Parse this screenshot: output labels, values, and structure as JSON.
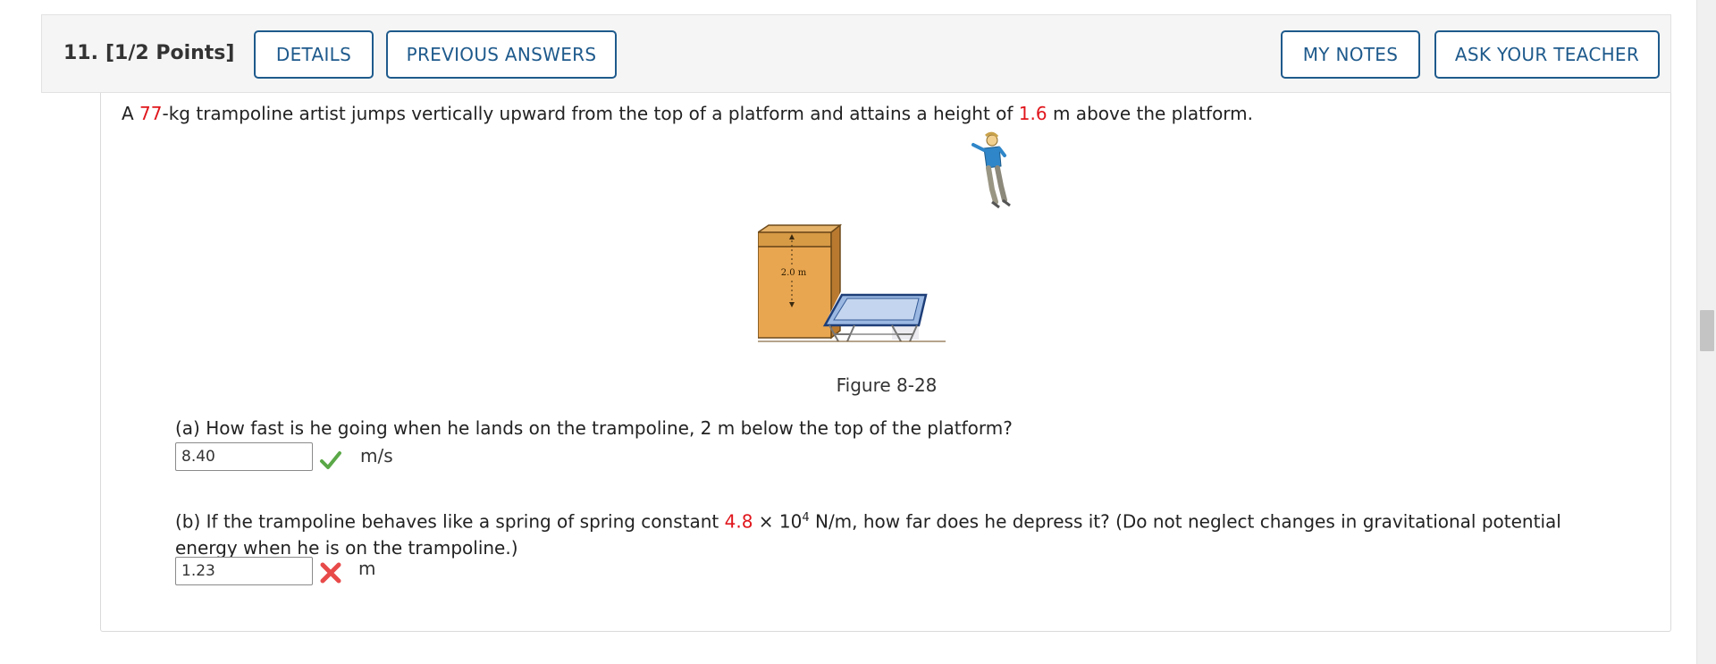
{
  "header": {
    "number": "11.",
    "points": "[1/2 Points]",
    "details_label": "DETAILS",
    "previous_answers_label": "PREVIOUS ANSWERS",
    "my_notes_label": "MY NOTES",
    "ask_teacher_label": "ASK YOUR TEACHER"
  },
  "statement": {
    "p1": "A ",
    "mass": "77",
    "p2": "-kg trampoline artist jumps vertically upward from the top of a platform and attains a height of ",
    "height": "1.6",
    "p3": " m above the platform."
  },
  "figure": {
    "platform_label": "2.0 m",
    "caption": "Figure 8-28"
  },
  "part_a": {
    "question": "(a) How fast is he going when he lands on the trampoline, 2 m below the top of the platform?",
    "answer": "8.40",
    "unit": "m/s",
    "status": "correct"
  },
  "part_b": {
    "q_p1": "(b) If the trampoline behaves like a spring of spring constant ",
    "k_value": "4.8",
    "q_p2": " × 10",
    "exponent": "4",
    "q_p3": " N/m, how far does he depress it? (Do not neglect changes in gravitational potential",
    "q_line2": "energy when he is on the trampoline.)",
    "answer": "1.23",
    "unit": "m",
    "status": "incorrect"
  },
  "colors": {
    "accent": "#1e5a8c",
    "highlight": "#e0161c",
    "correct": "#5aa847",
    "incorrect": "#e84a4a"
  }
}
